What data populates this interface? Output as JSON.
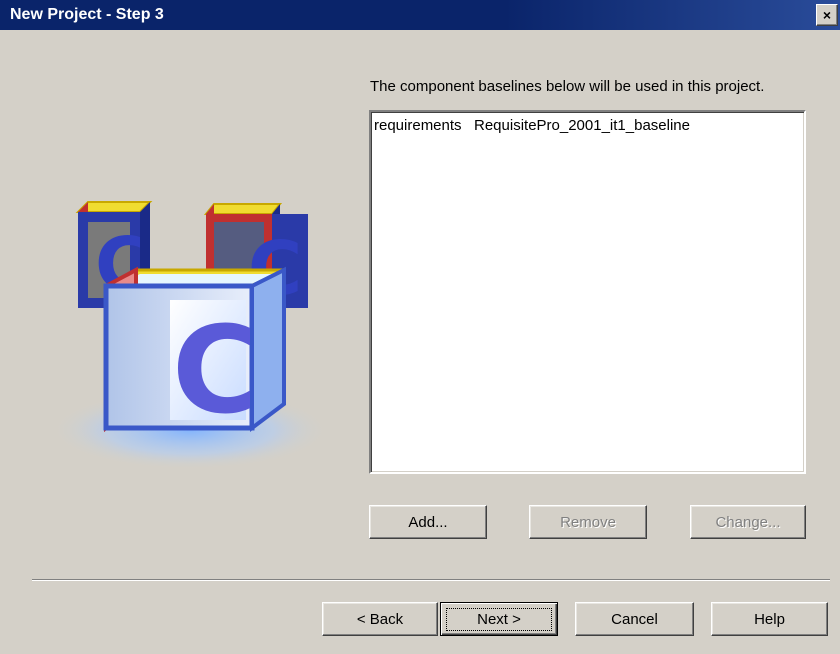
{
  "window": {
    "title": "New Project - Step 3",
    "close_glyph": "×"
  },
  "main": {
    "description": "The component baselines below will be used in this project.",
    "baselines": [
      {
        "component": "requirements",
        "baseline": "RequisitePro_2001_it1_baseline"
      }
    ]
  },
  "list_buttons": {
    "add": "Add...",
    "remove": "Remove",
    "change": "Change..."
  },
  "wizard_buttons": {
    "back": "< Back",
    "next": "Next >",
    "cancel": "Cancel",
    "help": "Help"
  },
  "illustration": {
    "block_letter": "C",
    "icon": "alphabet-blocks-icon"
  },
  "colors": {
    "titlebar": "#0a246a",
    "dialog_bg": "#d4d0c8",
    "disabled_text": "#808080"
  }
}
